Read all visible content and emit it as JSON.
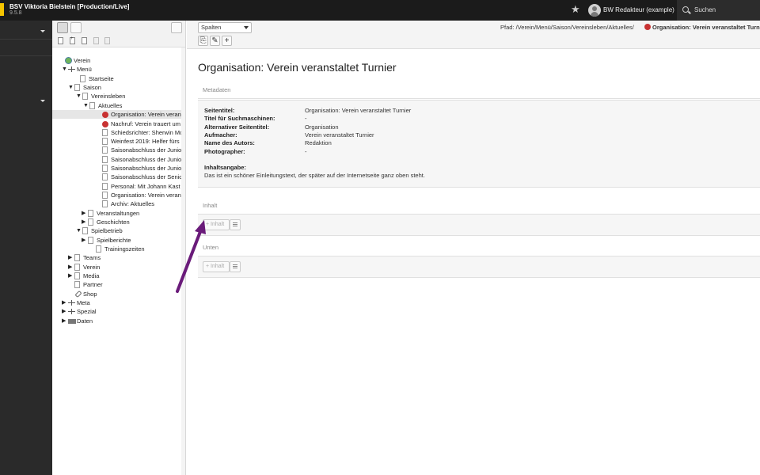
{
  "topbar": {
    "site_title": "BSV Viktoria Bielstein [Production/Live]",
    "version": "9.5.8",
    "user_name": "BW Redakteur (example)",
    "search_label": "Suchen"
  },
  "tree": {
    "nodes": [
      {
        "label": "Verein",
        "toggle": "",
        "icon": "globe"
      },
      {
        "label": "Menü",
        "toggle": "▼",
        "icon": "menu"
      },
      {
        "label": "Startseite",
        "toggle": "",
        "icon": "page"
      },
      {
        "label": "Saison",
        "toggle": "▼",
        "icon": "page"
      },
      {
        "label": "Vereinsleben",
        "toggle": "▼",
        "icon": "page"
      },
      {
        "label": "Aktuelles",
        "toggle": "▼",
        "icon": "page"
      },
      {
        "label": "Organisation: Verein veranstaltet Turnier",
        "toggle": "",
        "icon": "red",
        "selected": true
      },
      {
        "label": "Nachruf: Verein trauert um",
        "toggle": "",
        "icon": "red"
      },
      {
        "label": "Schiedsrichter: Sherwin Mo",
        "toggle": "",
        "icon": "page"
      },
      {
        "label": "Weinfest 2019: Helfer fürs",
        "toggle": "",
        "icon": "page"
      },
      {
        "label": "Saisonabschluss der Junioren",
        "toggle": "",
        "icon": "page"
      },
      {
        "label": "Saisonabschluss der Junioren",
        "toggle": "",
        "icon": "page"
      },
      {
        "label": "Saisonabschluss der Junioren",
        "toggle": "",
        "icon": "page"
      },
      {
        "label": "Saisonabschluss der Senioren",
        "toggle": "",
        "icon": "page"
      },
      {
        "label": "Personal: Mit Johann Kast wird",
        "toggle": "",
        "icon": "page"
      },
      {
        "label": "Organisation: Verein veranstaltet",
        "toggle": "",
        "icon": "page"
      },
      {
        "label": "Archiv: Aktuelles",
        "toggle": "",
        "icon": "page"
      },
      {
        "label": "Veranstaltungen",
        "toggle": "▶",
        "icon": "page"
      },
      {
        "label": "Geschichten",
        "toggle": "▶",
        "icon": "page"
      },
      {
        "label": "Spielbetrieb",
        "toggle": "▼",
        "icon": "page"
      },
      {
        "label": "Spielberichte",
        "toggle": "▶",
        "icon": "page"
      },
      {
        "label": "Trainingszeiten",
        "toggle": "",
        "icon": "page"
      },
      {
        "label": "Teams",
        "toggle": "▶",
        "icon": "page"
      },
      {
        "label": "Verein",
        "toggle": "▶",
        "icon": "page"
      },
      {
        "label": "Media",
        "toggle": "▶",
        "icon": "page"
      },
      {
        "label": "Partner",
        "toggle": "",
        "icon": "page"
      },
      {
        "label": "Shop",
        "toggle": "",
        "icon": "link"
      },
      {
        "label": "Meta",
        "toggle": "▶",
        "icon": "menu"
      },
      {
        "label": "Spezial",
        "toggle": "▶",
        "icon": "menu"
      },
      {
        "label": "Daten",
        "toggle": "▶",
        "icon": "folder"
      }
    ]
  },
  "docheader": {
    "view_select": "Spalten",
    "path_label": "Pfad: /Verein/Menü/Saison/Vereinsleben/Aktuelles/",
    "path_title": "Organisation: Verein veranstaltet Turnier"
  },
  "main": {
    "page_title": "Organisation: Verein veranstaltet Turnier",
    "metadata_heading": "Metadaten",
    "metadata": [
      {
        "key": "Seitentitel:",
        "value": "Organisation: Verein veranstaltet Turnier"
      },
      {
        "key": "Titel für Suchmaschinen:",
        "value": "-"
      },
      {
        "key": "Alternativer Seitentitel:",
        "value": "Organisation"
      },
      {
        "key": "Aufmacher:",
        "value": "Verein veranstaltet Turnier"
      },
      {
        "key": "Name des Autors:",
        "value": "Redaktion"
      },
      {
        "key": "Photographer:",
        "value": "-"
      }
    ],
    "abstract_label": "Inhaltsangabe:",
    "abstract_text": "Das ist ein schöner Einleitungstext, der später auf der Internetseite ganz oben steht.",
    "sections": [
      {
        "heading": "Inhalt",
        "button": "+ Inhalt"
      },
      {
        "heading": "Unten",
        "button": "+ Inhalt"
      }
    ]
  },
  "colors": {
    "topbar": "#1b1b1b",
    "modmenu": "#2a2a2a",
    "logo": "#f5c400",
    "annotation_arrow": "#6a1b7a",
    "hidden_page": "#c83232"
  }
}
